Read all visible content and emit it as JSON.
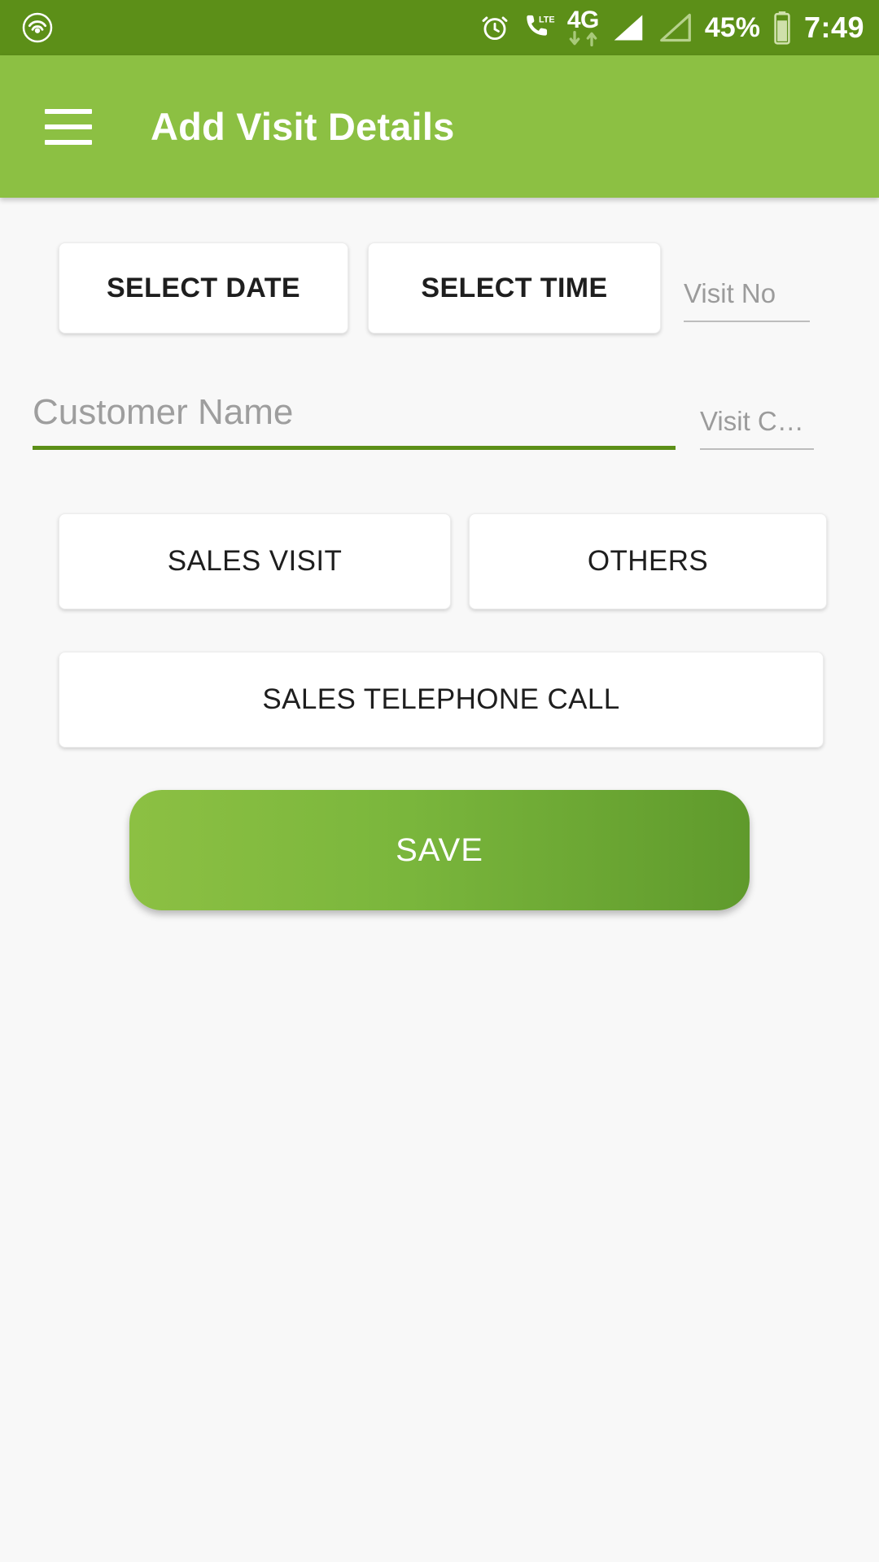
{
  "status_bar": {
    "cast_icon": "cast-broadcast-icon",
    "alarm_icon": "alarm-clock-icon",
    "call_icon": "phone-lte-icon",
    "lte_badge": "LTE",
    "network_label": "4G",
    "download_arrow": "arrow-down-icon",
    "upload_arrow": "arrow-up-icon",
    "signal_full_icon": "signal-bars-full-icon",
    "signal_empty_icon": "signal-bars-empty-icon",
    "battery_percent": "45%",
    "battery_icon": "battery-icon",
    "time": "7:49",
    "background_color": "#5c8f18"
  },
  "app_bar": {
    "menu_icon": "hamburger-menu-icon",
    "title": "Add Visit Details",
    "background_color": "#8cc043"
  },
  "form": {
    "select_date_label": "SELECT DATE",
    "select_time_label": "SELECT TIME",
    "visit_no": {
      "placeholder": "Visit No",
      "value": ""
    },
    "customer_name": {
      "placeholder": "Customer Name",
      "value": "",
      "focused": true,
      "underline_color": "#5c8f18"
    },
    "visit_c": {
      "placeholder": "Visit C…",
      "value": ""
    },
    "visit_types": [
      {
        "label": "SALES VISIT"
      },
      {
        "label": "OTHERS"
      },
      {
        "label": "SALES TELEPHONE CALL"
      }
    ],
    "save_label": "SAVE",
    "save_gradient_from": "#8cc043",
    "save_gradient_to": "#5f9a2c"
  }
}
